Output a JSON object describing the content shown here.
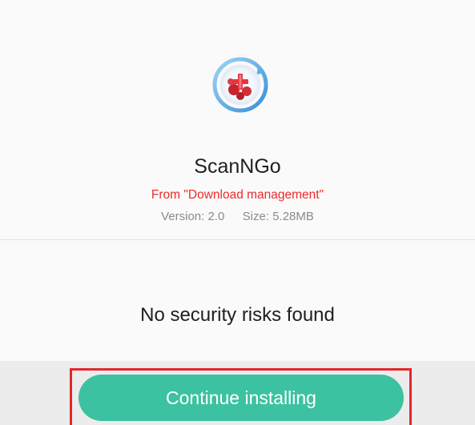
{
  "app": {
    "name": "ScanNGo",
    "source": "From \"Download management\"",
    "version_label": "Version:",
    "version_value": "2.0",
    "size_label": "Size:",
    "size_value": "5.28MB",
    "icon": "scanngo-app-icon"
  },
  "result": {
    "message": "No security risks found"
  },
  "actions": {
    "continue_label": "Continue installing"
  },
  "colors": {
    "accent": "#3cc2a0",
    "source_text": "#ee2a2a",
    "highlight": "#e3262d"
  }
}
